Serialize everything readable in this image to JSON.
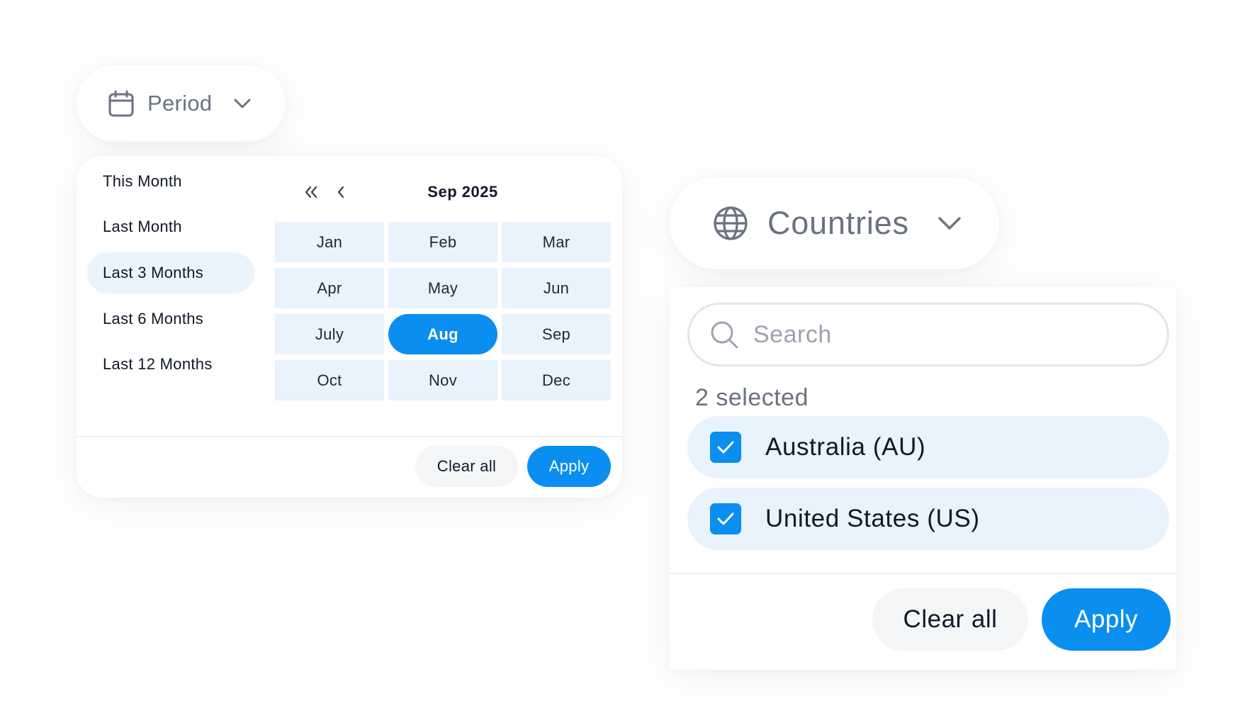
{
  "colors": {
    "accent": "#0a8ef0",
    "selection_bg": "#e9f3fd",
    "muted_text": "#6b7280",
    "neutral_button": "#f4f5f7"
  },
  "period": {
    "trigger": {
      "icon": "calendar-icon",
      "label": "Period",
      "chevron_icon": "chevron-down-icon"
    },
    "presets": [
      {
        "label": "This Month",
        "active": false
      },
      {
        "label": "Last Month",
        "active": false
      },
      {
        "label": "Last 3 Months",
        "active": true
      },
      {
        "label": "Last 6 Months",
        "active": false
      },
      {
        "label": "Last 12 Months",
        "active": false
      }
    ],
    "calendar": {
      "prev_year_icon": "double-chevron-left-icon",
      "prev_month_icon": "chevron-left-icon",
      "current_label": "Sep 2025",
      "months": [
        "Jan",
        "Feb",
        "Mar",
        "Apr",
        "May",
        "Jun",
        "July",
        "Aug",
        "Sep",
        "Oct",
        "Nov",
        "Dec"
      ],
      "selected_month": "Aug"
    },
    "buttons": {
      "clear_label": "Clear all",
      "apply_label": "Apply"
    }
  },
  "countries": {
    "trigger": {
      "icon": "globe-icon",
      "label": "Countries",
      "chevron_icon": "chevron-down-icon"
    },
    "search": {
      "icon": "search-icon",
      "placeholder": "Search",
      "value": ""
    },
    "selected_count_label": "2 selected",
    "items": [
      {
        "label": "Australia (AU)",
        "checked": true
      },
      {
        "label": "United States (US)",
        "checked": true
      }
    ],
    "buttons": {
      "clear_label": "Clear all",
      "apply_label": "Apply"
    }
  }
}
